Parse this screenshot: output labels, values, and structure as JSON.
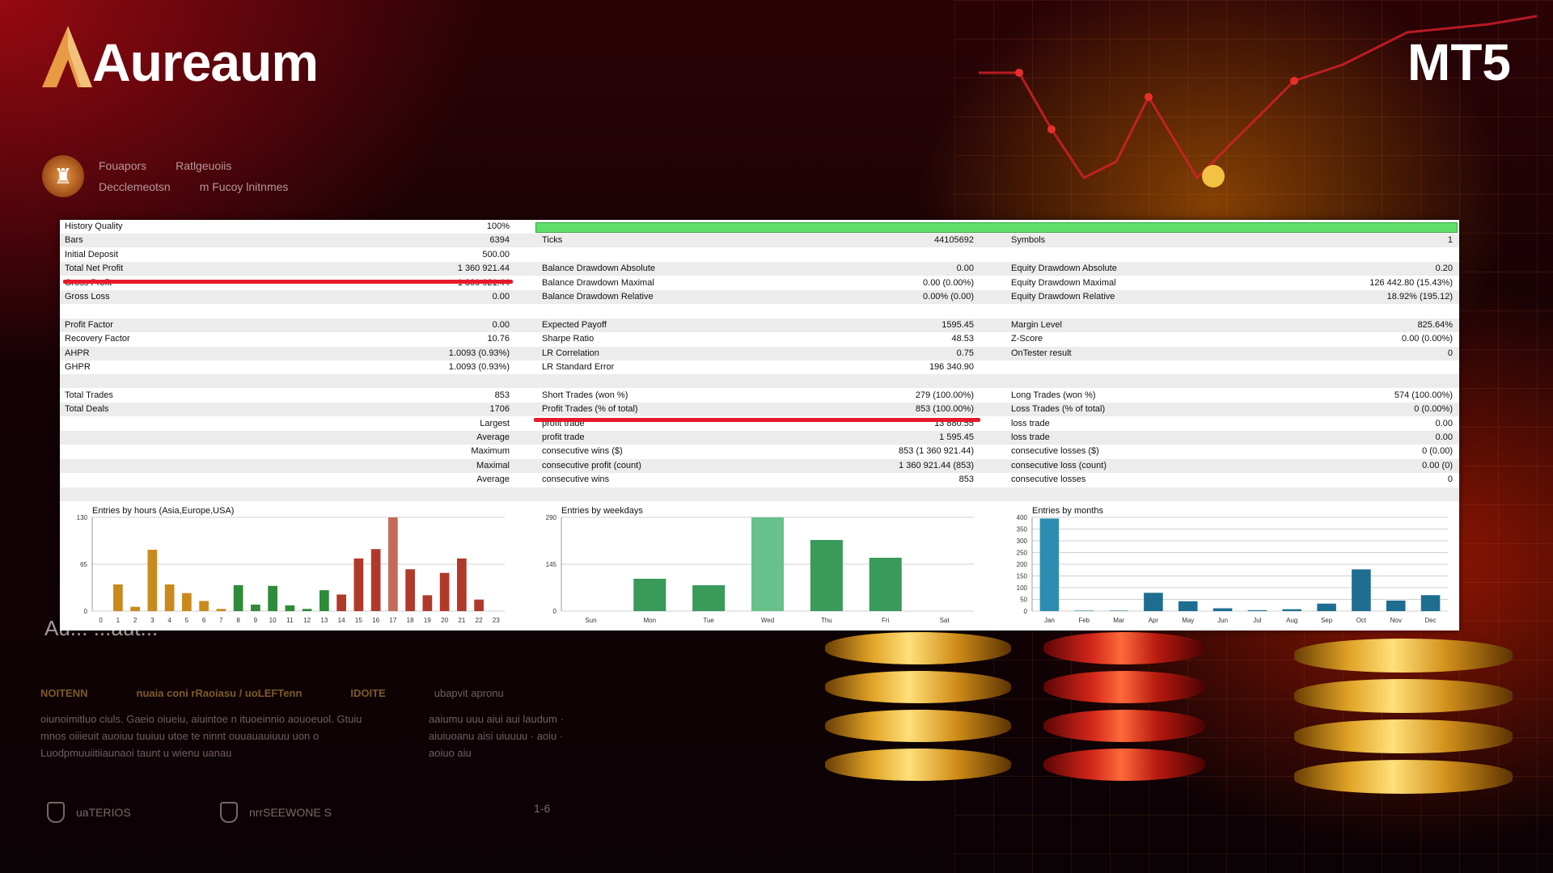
{
  "brand": {
    "name": "Aureaum",
    "platform": "MT5"
  },
  "badge": {
    "line1": [
      "Fouapors",
      "Ratlgeuoiis"
    ],
    "line2": [
      "Decclemeotsn",
      "m Fucoy lnitnmes"
    ]
  },
  "report": {
    "rows": [
      {
        "c1l": "History Quality",
        "c1v": "100%",
        "hq": true
      },
      {
        "c1l": "Bars",
        "c1v": "6394",
        "c2l": "Ticks",
        "c2v": "44105692",
        "c3l": "Symbols",
        "c3v": "1"
      },
      {
        "c1l": "Initial Deposit",
        "c1v": "500.00"
      },
      {
        "c1l": "Total Net Profit",
        "c1v": "1 360 921.44",
        "c2l": "Balance Drawdown Absolute",
        "c2v": "0.00",
        "c3l": "Equity Drawdown Absolute",
        "c3v": "0.20"
      },
      {
        "c1l": "Gross Profit",
        "c1v": "1 360 921.44",
        "c2l": "Balance Drawdown Maximal",
        "c2v": "0.00 (0.00%)",
        "c3l": "Equity Drawdown Maximal",
        "c3v": "126 442.80 (15.43%)"
      },
      {
        "c1l": "Gross Loss",
        "c1v": "0.00",
        "c2l": "Balance Drawdown Relative",
        "c2v": "0.00% (0.00)",
        "c3l": "Equity Drawdown Relative",
        "c3v": "18.92% (195.12)"
      },
      {},
      {
        "c1l": "Profit Factor",
        "c1v": "0.00",
        "c2l": "Expected Payoff",
        "c2v": "1595.45",
        "c3l": "Margin Level",
        "c3v": "825.64%"
      },
      {
        "c1l": "Recovery Factor",
        "c1v": "10.76",
        "c2l": "Sharpe Ratio",
        "c2v": "48.53",
        "c3l": "Z-Score",
        "c3v": "0.00 (0.00%)"
      },
      {
        "c1l": "AHPR",
        "c1v": "1.0093 (0.93%)",
        "c2l": "LR Correlation",
        "c2v": "0.75",
        "c3l": "OnTester result",
        "c3v": "0"
      },
      {
        "c1l": "GHPR",
        "c1v": "1.0093 (0.93%)",
        "c2l": "LR Standard Error",
        "c2v": "196 340.90"
      },
      {},
      {
        "c1l": "Total Trades",
        "c1v": "853",
        "c2l": "Short Trades (won %)",
        "c2v": "279 (100.00%)",
        "c3l": "Long Trades (won %)",
        "c3v": "574 (100.00%)"
      },
      {
        "c1l": "Total Deals",
        "c1v": "1706",
        "c2l": "Profit Trades (% of total)",
        "c2v": "853 (100.00%)",
        "c3l": "Loss Trades (% of total)",
        "c3v": "0 (0.00%)"
      },
      {
        "c1r": "Largest",
        "c2l": "profit trade",
        "c2v": "13 880.55",
        "c3l": "loss trade",
        "c3v": "0.00"
      },
      {
        "c1r": "Average",
        "c2l": "profit trade",
        "c2v": "1 595.45",
        "c3l": "loss trade",
        "c3v": "0.00"
      },
      {
        "c1r": "Maximum",
        "c2l": "consecutive wins ($)",
        "c2v": "853 (1 360 921.44)",
        "c3l": "consecutive losses ($)",
        "c3v": "0 (0.00)"
      },
      {
        "c1r": "Maximal",
        "c2l": "consecutive profit (count)",
        "c2v": "1 360 921.44 (853)",
        "c3l": "consecutive loss (count)",
        "c3v": "0.00 (0)"
      },
      {
        "c1r": "Average",
        "c2l": "consecutive wins",
        "c2v": "853",
        "c3l": "consecutive losses",
        "c3v": "0"
      },
      {}
    ]
  },
  "chart_data": [
    {
      "type": "bar",
      "title": "Entries by hours (Asia,Europe,USA)",
      "categories": [
        "0",
        "1",
        "2",
        "3",
        "4",
        "5",
        "6",
        "7",
        "8",
        "9",
        "10",
        "11",
        "12",
        "13",
        "14",
        "15",
        "16",
        "17",
        "18",
        "19",
        "20",
        "21",
        "22",
        "23"
      ],
      "values": [
        0,
        37,
        6,
        85,
        37,
        25,
        14,
        3,
        36,
        9,
        35,
        8,
        3,
        29,
        23,
        73,
        86,
        130,
        58,
        22,
        53,
        73,
        16,
        0
      ],
      "ylim": [
        0,
        130
      ],
      "yticks": [
        "130",
        "65",
        "0"
      ],
      "colors": [
        "#c98a1c",
        "#c98a1c",
        "#c98a1c",
        "#c98a1c",
        "#c98a1c",
        "#c98a1c",
        "#c98a1c",
        "#c98a1c",
        "#2e8b3a",
        "#2e8b3a",
        "#2e8b3a",
        "#2e8b3a",
        "#2e8b3a",
        "#2e8b3a",
        "#b03a2a",
        "#b03a2a",
        "#b03a2a",
        "#c46a5a",
        "#b03a2a",
        "#b03a2a",
        "#b03a2a",
        "#b03a2a",
        "#b03a2a",
        "#b03a2a"
      ]
    },
    {
      "type": "bar",
      "title": "Entries by weekdays",
      "categories": [
        "Sun",
        "Mon",
        "Tue",
        "Wed",
        "Thu",
        "Fri",
        "Sat"
      ],
      "values": [
        0,
        100,
        80,
        290,
        220,
        165,
        0
      ],
      "ylim": [
        0,
        290
      ],
      "yticks": [
        "290",
        "145",
        "0"
      ],
      "colors": [
        "#3a9a5a",
        "#3a9a5a",
        "#3a9a5a",
        "#66c28a",
        "#3a9a5a",
        "#3a9a5a",
        "#3a9a5a"
      ]
    },
    {
      "type": "bar",
      "title": "Entries by months",
      "categories": [
        "Jan",
        "Feb",
        "Mar",
        "Apr",
        "May",
        "Jun",
        "Jul",
        "Aug",
        "Sep",
        "Oct",
        "Nov",
        "Dec"
      ],
      "values": [
        395,
        2,
        2,
        78,
        42,
        12,
        4,
        8,
        32,
        178,
        45,
        68
      ],
      "ylim": [
        0,
        400
      ],
      "yticks": [
        "400",
        "350",
        "300",
        "250",
        "200",
        "150",
        "100",
        "50",
        "0"
      ],
      "colors": [
        "#2d8db0",
        "#1e6e92",
        "#1e6e92",
        "#1e6e92",
        "#1e6e92",
        "#1e6e92",
        "#1e6e92",
        "#1e6e92",
        "#1e6e92",
        "#1e6e92",
        "#1e6e92",
        "#1e6e92"
      ]
    }
  ],
  "lower": {
    "ghost_title": "Au... ...aut...",
    "col1_head": "NOITENN",
    "col2_head": "nuaia coni rRaoiasu / uoLEFTenn",
    "col3_head": "IDOITE",
    "col4_head": "ubapvit apronu",
    "col1_body": "oiunoimitluo ciuls. Gaeio oiueiu, aiuintoe n ituoeinnio aouoeuol. Gtuiu mnos oiiieuit auoiuu tuuiuu utoe te ninnt ouuauauiuuu uon o Luodpmuuiitiiaunaoi taunt u wienu uanau",
    "col3_body": "aaiumu uuu aiui aui laudum · aiuiuoanu aisi uiuuuu · aoiu · aoiuo aiu",
    "footer1": "uaTERIOS",
    "footer2": "nrrSEEWONE S",
    "footer3": "1-6"
  },
  "colors": {
    "accent": "#e8182c",
    "hq_bar": "#5ee06a",
    "gold": "#e0a326"
  }
}
